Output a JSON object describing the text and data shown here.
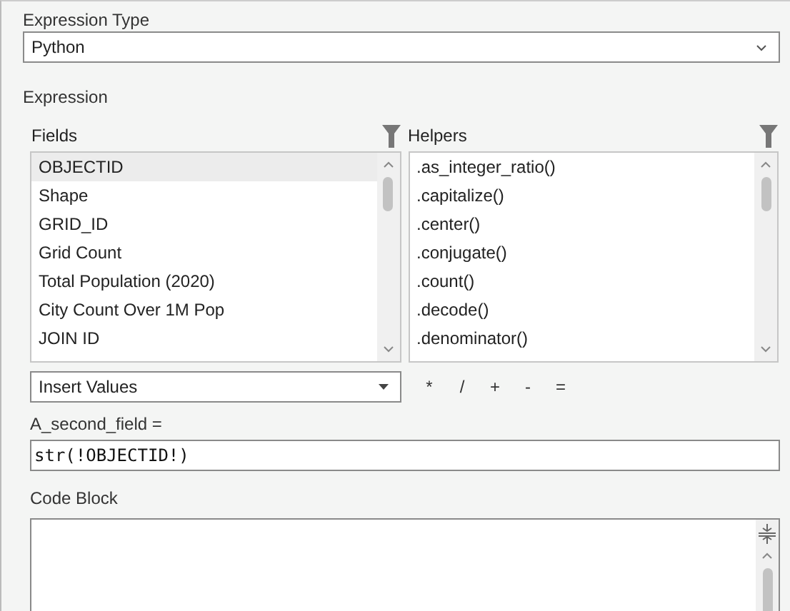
{
  "expression_type": {
    "label": "Expression Type",
    "value": "Python"
  },
  "expression": {
    "label": "Expression"
  },
  "fields": {
    "label": "Fields",
    "items": [
      {
        "label": "OBJECTID",
        "selected": true
      },
      {
        "label": "Shape",
        "selected": false
      },
      {
        "label": "GRID_ID",
        "selected": false
      },
      {
        "label": "Grid Count",
        "selected": false
      },
      {
        "label": "Total Population (2020)",
        "selected": false
      },
      {
        "label": "City Count Over 1M Pop",
        "selected": false
      },
      {
        "label": "JOIN ID",
        "selected": false
      }
    ]
  },
  "helpers": {
    "label": "Helpers",
    "items": [
      {
        "label": ".as_integer_ratio()",
        "selected": false
      },
      {
        "label": ".capitalize()",
        "selected": false
      },
      {
        "label": ".center()",
        "selected": false
      },
      {
        "label": ".conjugate()",
        "selected": false
      },
      {
        "label": ".count()",
        "selected": false
      },
      {
        "label": ".decode()",
        "selected": false
      },
      {
        "label": ".denominator()",
        "selected": false
      }
    ]
  },
  "insert_values": {
    "value": "Insert Values"
  },
  "operators": [
    "*",
    "/",
    "+",
    "-",
    "="
  ],
  "target": {
    "label": "A_second_field =",
    "value": "str(!OBJECTID!)"
  },
  "code_block": {
    "label": "Code Block"
  }
}
